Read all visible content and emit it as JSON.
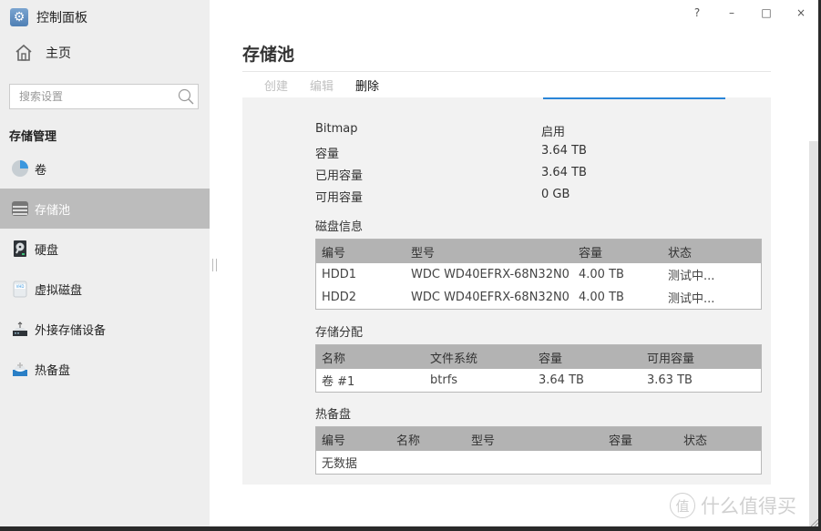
{
  "app": {
    "title": "控制面板",
    "icon": "gear-icon"
  },
  "window_controls": {
    "help": "?",
    "minimize": "–",
    "maximize": "□",
    "close": "×"
  },
  "sidebar": {
    "home_label": "主页",
    "search_placeholder": "搜索设置",
    "section_title": "存储管理",
    "items": [
      {
        "label": "卷",
        "icon": "pie-chart-icon",
        "active": false
      },
      {
        "label": "存储池",
        "icon": "storage-pool-icon",
        "active": true
      },
      {
        "label": "硬盘",
        "icon": "hard-disk-icon",
        "active": false
      },
      {
        "label": "虚拟磁盘",
        "icon": "vhd-icon",
        "active": false
      },
      {
        "label": "外接存储设备",
        "icon": "usb-drive-icon",
        "active": false
      },
      {
        "label": "热备盘",
        "icon": "hot-spare-icon",
        "active": false
      }
    ]
  },
  "main": {
    "title": "存储池",
    "toolbar": {
      "create": "创建",
      "edit": "编辑",
      "delete": "删除"
    },
    "accent_color": "#2a85d8",
    "properties": [
      {
        "key": "Bitmap",
        "value": "启用"
      },
      {
        "key": "容量",
        "value": "3.64 TB"
      },
      {
        "key": "已用容量",
        "value": "3.64 TB"
      },
      {
        "key": "可用容量",
        "value": "0 GB"
      }
    ],
    "disk_info": {
      "label": "磁盘信息",
      "columns": [
        "编号",
        "型号",
        "容量",
        "状态"
      ],
      "rows": [
        [
          "HDD1",
          "WDC WD40EFRX-68N32N0",
          "4.00 TB",
          "测试中..."
        ],
        [
          "HDD2",
          "WDC WD40EFRX-68N32N0",
          "4.00 TB",
          "测试中..."
        ]
      ]
    },
    "allocation": {
      "label": "存储分配",
      "columns": [
        "名称",
        "文件系统",
        "容量",
        "可用容量"
      ],
      "rows": [
        [
          "卷 #1",
          "btrfs",
          "3.64 TB",
          "3.63 TB"
        ]
      ]
    },
    "hot_spare": {
      "label": "热备盘",
      "columns": [
        "编号",
        "名称",
        "型号",
        "容量",
        "状态"
      ],
      "empty_text": "无数据"
    }
  },
  "watermark": {
    "badge": "值",
    "text": "什么值得买"
  }
}
